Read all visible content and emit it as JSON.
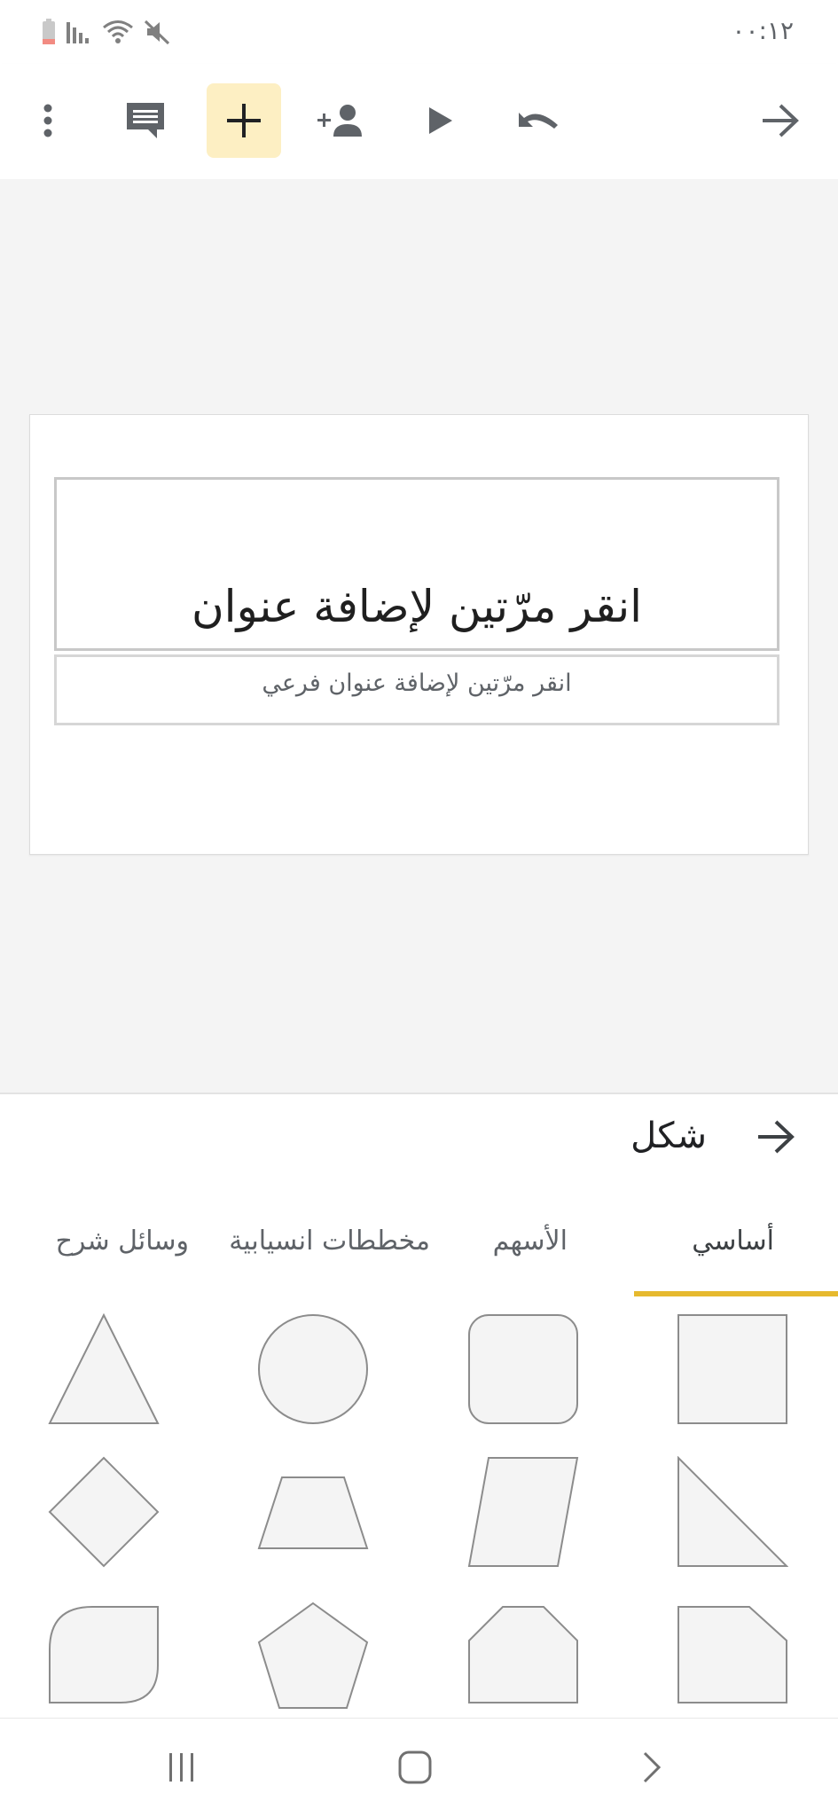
{
  "status_bar": {
    "time": "٠٠:١٢",
    "icons": [
      "battery-low-icon",
      "signal-icon",
      "wifi-icon",
      "mute-icon"
    ]
  },
  "toolbar": {
    "buttons": [
      "more-vert-icon",
      "comment-icon",
      "add-icon",
      "add-person-icon",
      "play-icon",
      "undo-icon",
      "back-arrow-icon"
    ],
    "active_button": "add-icon",
    "accent": "#fdefc3"
  },
  "slide": {
    "title_placeholder": "انقر مرّتين لإضافة عنوان",
    "subtitle_placeholder": "انقر مرّتين لإضافة عنوان فرعي"
  },
  "shape_panel": {
    "title": "شكل",
    "tabs": [
      {
        "label": "أساسي",
        "selected": true
      },
      {
        "label": "الأسهم",
        "selected": false
      },
      {
        "label": "مخططات انسيابية",
        "selected": false
      },
      {
        "label": "وسائل شرح",
        "selected": false
      }
    ],
    "indicator_color": "#e6b92e",
    "shapes": [
      "rectangle",
      "rounded-rectangle",
      "ellipse",
      "triangle",
      "right-triangle",
      "parallelogram",
      "trapezoid",
      "diamond",
      "snip-corner-rectangle",
      "snip-corners-rectangle",
      "pentagon",
      "round-corner-rectangle"
    ]
  },
  "nav_bar": {
    "buttons": [
      "recent-apps-icon",
      "home-icon",
      "back-icon"
    ]
  }
}
